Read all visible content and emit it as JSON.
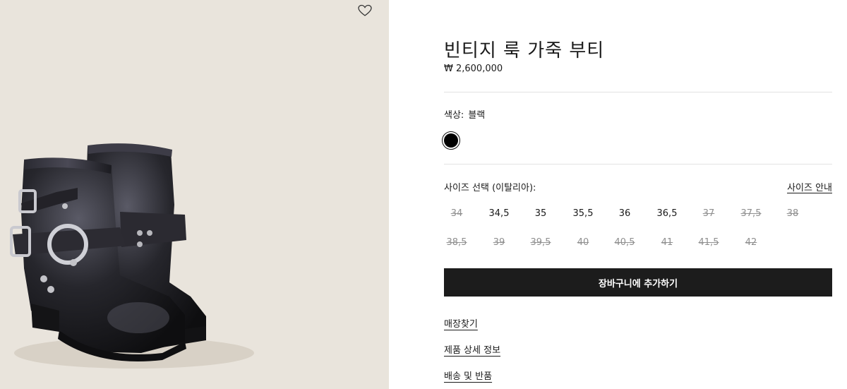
{
  "product": {
    "title": "빈티지 룩 가죽 부티",
    "price": "₩ 2,600,000"
  },
  "color": {
    "label": "색상:",
    "value": "블랙",
    "swatch": "#000000"
  },
  "sizes": {
    "label": "사이즈 선택 (이탈리아):",
    "guide_label": "사이즈 안내",
    "row1": [
      {
        "label": "34",
        "available": false
      },
      {
        "label": "34,5",
        "available": true
      },
      {
        "label": "35",
        "available": true
      },
      {
        "label": "35,5",
        "available": true
      },
      {
        "label": "36",
        "available": true
      },
      {
        "label": "36,5",
        "available": true
      },
      {
        "label": "37",
        "available": false
      },
      {
        "label": "37,5",
        "available": false
      },
      {
        "label": "38",
        "available": false
      }
    ],
    "row2": [
      {
        "label": "38,5",
        "available": false
      },
      {
        "label": "39",
        "available": false
      },
      {
        "label": "39,5",
        "available": false
      },
      {
        "label": "40",
        "available": false
      },
      {
        "label": "40,5",
        "available": false
      },
      {
        "label": "41",
        "available": false
      },
      {
        "label": "41,5",
        "available": false
      },
      {
        "label": "42",
        "available": false
      }
    ]
  },
  "actions": {
    "add_to_cart": "장바구니에 추가하기"
  },
  "links": {
    "store_finder": "매장찾기",
    "product_details": "제품 상세 정보",
    "shipping_returns": "배송 및 반품"
  },
  "colors": {
    "image_background": "#e9e4dc",
    "button_background": "#1c1c1c",
    "unavailable_text": "#8f8f8f"
  },
  "icons": {
    "wishlist": "heart-outline-icon"
  }
}
